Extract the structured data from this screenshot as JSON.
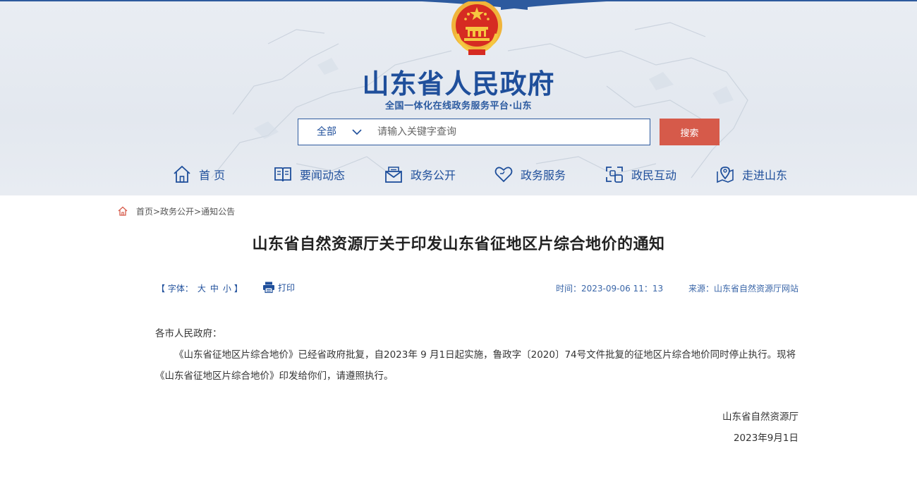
{
  "header": {
    "site_title": "山东省人民政府",
    "site_subtitle": "全国一体化在线政务服务平台·山东"
  },
  "search": {
    "scope_label": "全部",
    "placeholder": "请输入关键字查询",
    "button_label": "搜索"
  },
  "nav": {
    "items": [
      {
        "label": "首 页",
        "icon": "home-icon"
      },
      {
        "label": "要闻动态",
        "icon": "book-icon"
      },
      {
        "label": "政务公开",
        "icon": "mail-icon"
      },
      {
        "label": "政务服务",
        "icon": "heart-icon"
      },
      {
        "label": "政民互动",
        "icon": "interaction-icon"
      },
      {
        "label": "走进山东",
        "icon": "map-pin-icon"
      }
    ]
  },
  "breadcrumb": {
    "text": "首页>政务公开>通知公告"
  },
  "article": {
    "title": "山东省自然资源厅关于印发山东省征地区片综合地价的通知",
    "font_label_open": "【 字体：",
    "font_large": "大",
    "font_medium": "中",
    "font_small": "小",
    "font_label_close": "】",
    "print_label": "打印",
    "time": "时间：2023-09-06 11：13",
    "source": "来源：山东省自然资源厅网站",
    "salutation": "各市人民政府：",
    "paragraph": "《山东省征地区片综合地价》已经省政府批复，自2023年 9 月1日起实施，鲁政字〔2020〕74号文件批复的征地区片综合地价同时停止执行。现将《山东省征地区片综合地价》印发给你们，请遵照执行。",
    "signature_org": "山东省自然资源厅",
    "signature_date": "2023年9月1日"
  },
  "colors": {
    "brand_blue": "#1f4f9b",
    "search_button": "#d65a4a",
    "header_bg": "#e6ebf1"
  }
}
